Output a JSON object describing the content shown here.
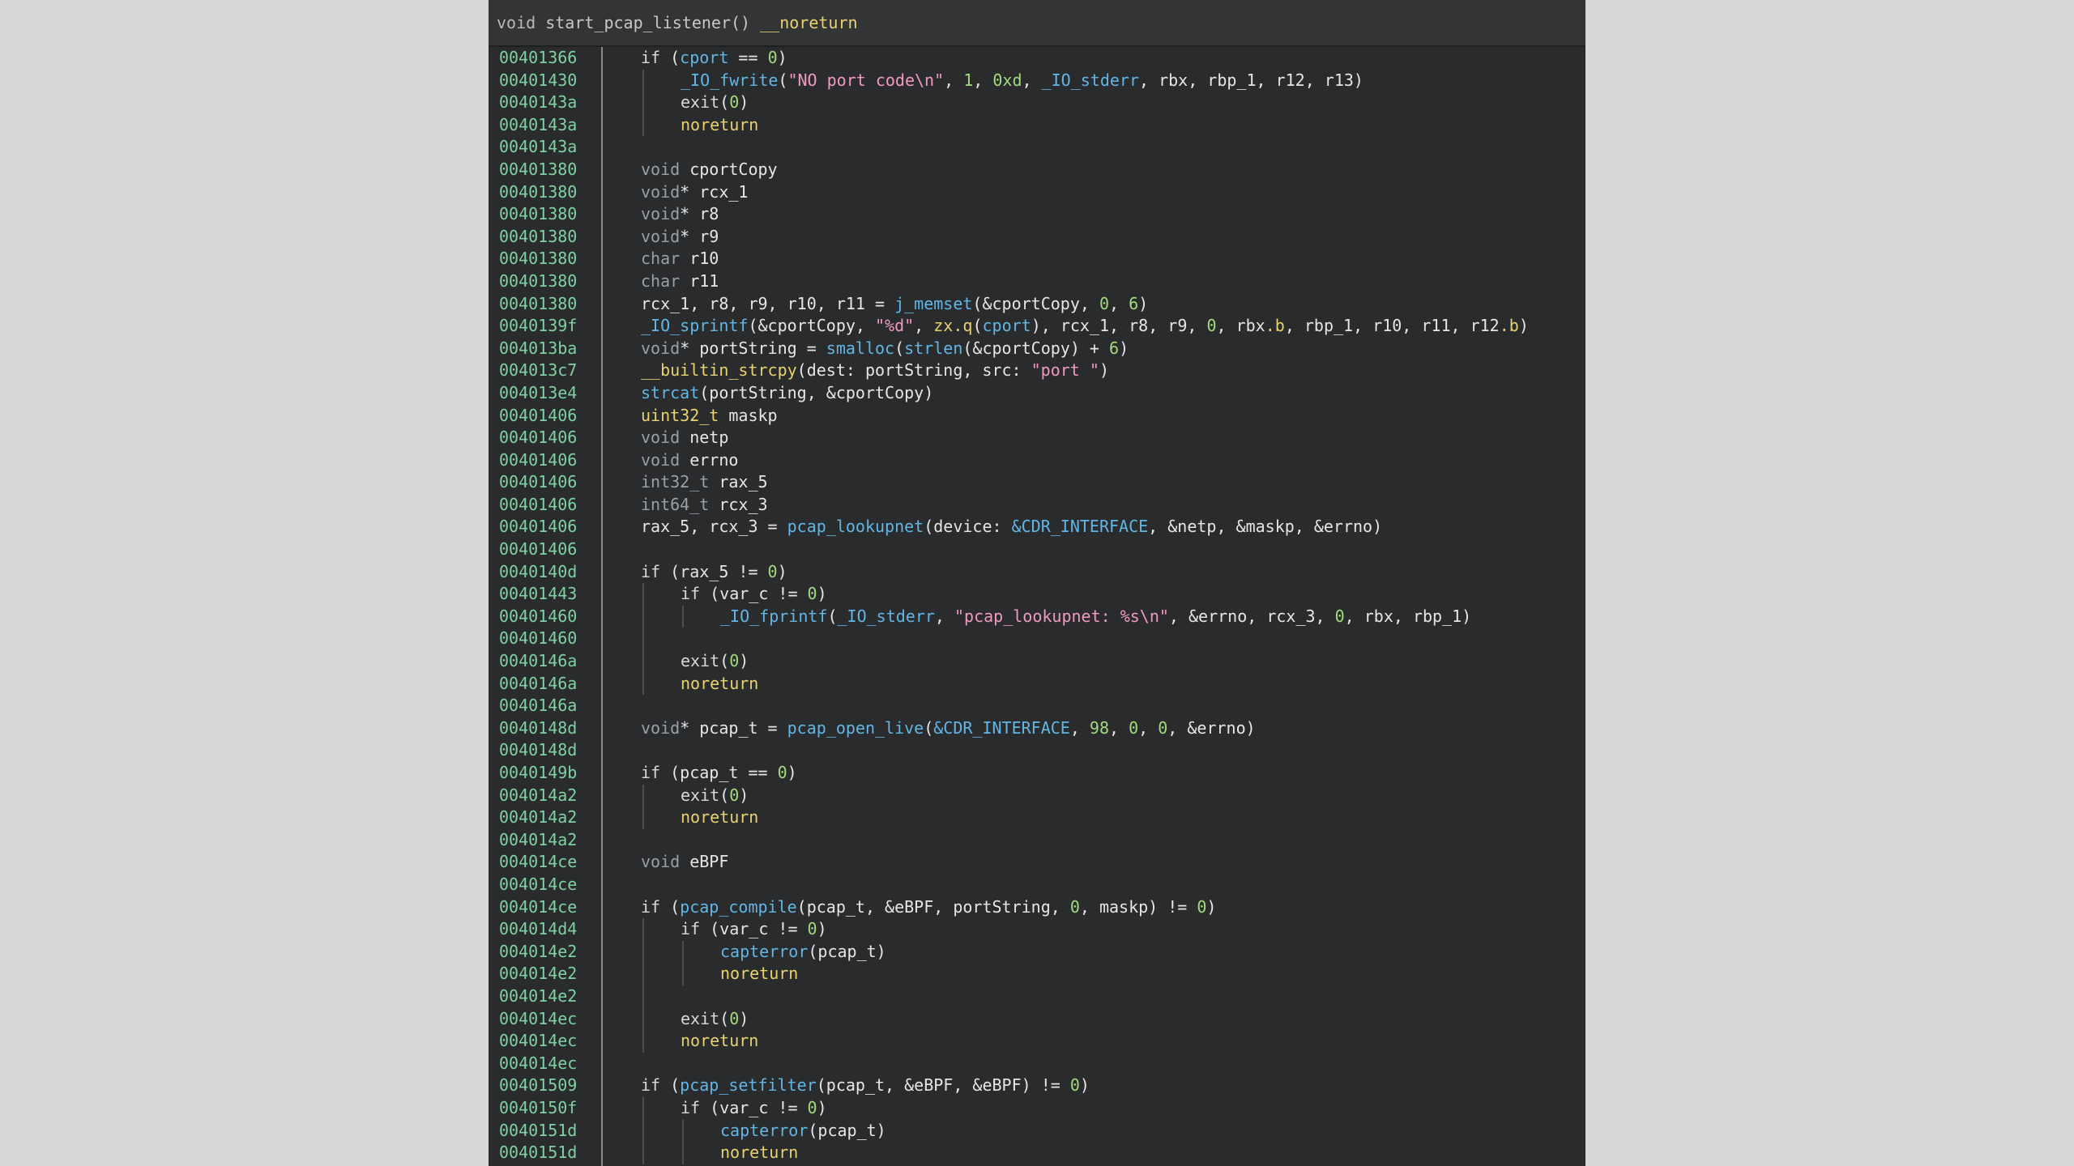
{
  "header": {
    "ret": "void",
    "name": "start_pcap_listener()",
    "attr": "__noreturn"
  },
  "lines": [
    {
      "addr": "00401366",
      "indent": 0,
      "tokens": [
        [
          "kw",
          "if "
        ],
        [
          "",
          ""
        ],
        [
          "",
          "("
        ],
        [
          "fn",
          "cport"
        ],
        [
          "",
          " == "
        ],
        [
          "num",
          "0"
        ],
        [
          "",
          ")"
        ]
      ]
    },
    {
      "addr": "00401430",
      "indent": 1,
      "tokens": [
        [
          "fn",
          "_IO_fwrite"
        ],
        [
          "",
          "("
        ],
        [
          "str",
          "\"NO port code\\n\""
        ],
        [
          "",
          ", "
        ],
        [
          "num",
          "1"
        ],
        [
          "",
          ", "
        ],
        [
          "num",
          "0xd"
        ],
        [
          "",
          ", "
        ],
        [
          "fn",
          "_IO_stderr"
        ],
        [
          "",
          ", rbx, rbp_1, r12, r13)"
        ]
      ]
    },
    {
      "addr": "0040143a",
      "indent": 1,
      "tokens": [
        [
          "kw",
          "exit"
        ],
        [
          "",
          "("
        ],
        [
          "num",
          "0"
        ],
        [
          "",
          ")"
        ]
      ]
    },
    {
      "addr": "0040143a",
      "indent": 1,
      "tokens": [
        [
          "ylw",
          "noreturn"
        ]
      ]
    },
    {
      "addr": "0040143a",
      "indent": 0,
      "tokens": []
    },
    {
      "addr": "00401380",
      "indent": 0,
      "tokens": [
        [
          "ty",
          "void "
        ],
        [
          "",
          "cportCopy"
        ]
      ]
    },
    {
      "addr": "00401380",
      "indent": 0,
      "tokens": [
        [
          "ty",
          "void"
        ],
        [
          "",
          "* rcx_1"
        ]
      ]
    },
    {
      "addr": "00401380",
      "indent": 0,
      "tokens": [
        [
          "ty",
          "void"
        ],
        [
          "",
          "* r8"
        ]
      ]
    },
    {
      "addr": "00401380",
      "indent": 0,
      "tokens": [
        [
          "ty",
          "void"
        ],
        [
          "",
          "* r9"
        ]
      ]
    },
    {
      "addr": "00401380",
      "indent": 0,
      "tokens": [
        [
          "ty",
          "char "
        ],
        [
          "",
          "r10"
        ]
      ]
    },
    {
      "addr": "00401380",
      "indent": 0,
      "tokens": [
        [
          "ty",
          "char "
        ],
        [
          "",
          "r11"
        ]
      ]
    },
    {
      "addr": "00401380",
      "indent": 0,
      "tokens": [
        [
          "",
          "rcx_1, r8, r9, r10, r11 = "
        ],
        [
          "fn",
          "j_memset"
        ],
        [
          "",
          "(&cportCopy, "
        ],
        [
          "num",
          "0"
        ],
        [
          "",
          ", "
        ],
        [
          "num",
          "6"
        ],
        [
          "",
          ")"
        ]
      ]
    },
    {
      "addr": "0040139f",
      "indent": 0,
      "tokens": [
        [
          "fn",
          "_IO_sprintf"
        ],
        [
          "",
          "(&cportCopy, "
        ],
        [
          "str",
          "\"%d\""
        ],
        [
          "",
          ", "
        ],
        [
          "ylw",
          "zx.q"
        ],
        [
          "",
          "("
        ],
        [
          "fn",
          "cport"
        ],
        [
          "",
          "), rcx_1, r8, r9, "
        ],
        [
          "num",
          "0"
        ],
        [
          "",
          ", rbx"
        ],
        [
          "ylw",
          ".b"
        ],
        [
          "",
          ", rbp_1, r10, r11, r12"
        ],
        [
          "ylw",
          ".b"
        ],
        [
          "",
          ")"
        ]
      ]
    },
    {
      "addr": "004013ba",
      "indent": 0,
      "tokens": [
        [
          "ty",
          "void"
        ],
        [
          "",
          "* portString = "
        ],
        [
          "fn",
          "smalloc"
        ],
        [
          "",
          "("
        ],
        [
          "fn",
          "strlen"
        ],
        [
          "",
          "(&cportCopy) + "
        ],
        [
          "num",
          "6"
        ],
        [
          "",
          ")"
        ]
      ]
    },
    {
      "addr": "004013c7",
      "indent": 0,
      "tokens": [
        [
          "ylw",
          "__builtin_strcpy"
        ],
        [
          "",
          "(dest: portString, src: "
        ],
        [
          "str",
          "\"port \""
        ],
        [
          "",
          ")"
        ]
      ]
    },
    {
      "addr": "004013e4",
      "indent": 0,
      "tokens": [
        [
          "fn",
          "strcat"
        ],
        [
          "",
          "(portString, &cportCopy)"
        ]
      ]
    },
    {
      "addr": "00401406",
      "indent": 0,
      "tokens": [
        [
          "ylw",
          "uint32_t "
        ],
        [
          "",
          "maskp"
        ]
      ]
    },
    {
      "addr": "00401406",
      "indent": 0,
      "tokens": [
        [
          "ty",
          "void "
        ],
        [
          "",
          "netp"
        ]
      ]
    },
    {
      "addr": "00401406",
      "indent": 0,
      "tokens": [
        [
          "ty",
          "void "
        ],
        [
          "",
          "errno"
        ]
      ]
    },
    {
      "addr": "00401406",
      "indent": 0,
      "tokens": [
        [
          "ty",
          "int32_t "
        ],
        [
          "",
          "rax_5"
        ]
      ]
    },
    {
      "addr": "00401406",
      "indent": 0,
      "tokens": [
        [
          "ty",
          "int64_t "
        ],
        [
          "",
          "rcx_3"
        ]
      ]
    },
    {
      "addr": "00401406",
      "indent": 0,
      "tokens": [
        [
          "",
          "rax_5, rcx_3 = "
        ],
        [
          "fn",
          "pcap_lookupnet"
        ],
        [
          "",
          "(device: "
        ],
        [
          "fn",
          "&CDR_INTERFACE"
        ],
        [
          "",
          ", &netp, &maskp, &errno)"
        ]
      ]
    },
    {
      "addr": "00401406",
      "indent": 0,
      "tokens": []
    },
    {
      "addr": "0040140d",
      "indent": 0,
      "tokens": [
        [
          "kw",
          "if "
        ],
        [
          "",
          "(rax_5 != "
        ],
        [
          "num",
          "0"
        ],
        [
          "",
          ")"
        ]
      ]
    },
    {
      "addr": "00401443",
      "indent": 1,
      "tokens": [
        [
          "kw",
          "if "
        ],
        [
          "",
          "(var_c != "
        ],
        [
          "num",
          "0"
        ],
        [
          "",
          ")"
        ]
      ]
    },
    {
      "addr": "00401460",
      "indent": 2,
      "tokens": [
        [
          "fn",
          "_IO_fprintf"
        ],
        [
          "",
          "("
        ],
        [
          "fn",
          "_IO_stderr"
        ],
        [
          "",
          ", "
        ],
        [
          "str",
          "\"pcap_lookupnet: %s\\n\""
        ],
        [
          "",
          ", &errno, rcx_3, "
        ],
        [
          "num",
          "0"
        ],
        [
          "",
          ", rbx, rbp_1)"
        ]
      ]
    },
    {
      "addr": "00401460",
      "indent": 1,
      "tokens": []
    },
    {
      "addr": "0040146a",
      "indent": 1,
      "tokens": [
        [
          "kw",
          "exit"
        ],
        [
          "",
          "("
        ],
        [
          "num",
          "0"
        ],
        [
          "",
          ")"
        ]
      ]
    },
    {
      "addr": "0040146a",
      "indent": 1,
      "tokens": [
        [
          "ylw",
          "noreturn"
        ]
      ]
    },
    {
      "addr": "0040146a",
      "indent": 0,
      "tokens": []
    },
    {
      "addr": "0040148d",
      "indent": 0,
      "tokens": [
        [
          "ty",
          "void"
        ],
        [
          "",
          "* pcap_t = "
        ],
        [
          "fn",
          "pcap_open_live"
        ],
        [
          "",
          "("
        ],
        [
          "fn",
          "&CDR_INTERFACE"
        ],
        [
          "",
          ", "
        ],
        [
          "num",
          "98"
        ],
        [
          "",
          ", "
        ],
        [
          "num",
          "0"
        ],
        [
          "",
          ", "
        ],
        [
          "num",
          "0"
        ],
        [
          "",
          ", &errno)"
        ]
      ]
    },
    {
      "addr": "0040148d",
      "indent": 0,
      "tokens": []
    },
    {
      "addr": "0040149b",
      "indent": 0,
      "tokens": [
        [
          "kw",
          "if "
        ],
        [
          "",
          "(pcap_t == "
        ],
        [
          "num",
          "0"
        ],
        [
          "",
          ")"
        ]
      ]
    },
    {
      "addr": "004014a2",
      "indent": 1,
      "tokens": [
        [
          "kw",
          "exit"
        ],
        [
          "",
          "("
        ],
        [
          "num",
          "0"
        ],
        [
          "",
          ")"
        ]
      ]
    },
    {
      "addr": "004014a2",
      "indent": 1,
      "tokens": [
        [
          "ylw",
          "noreturn"
        ]
      ]
    },
    {
      "addr": "004014a2",
      "indent": 0,
      "tokens": []
    },
    {
      "addr": "004014ce",
      "indent": 0,
      "tokens": [
        [
          "ty",
          "void "
        ],
        [
          "",
          "eBPF"
        ]
      ]
    },
    {
      "addr": "004014ce",
      "indent": 0,
      "tokens": []
    },
    {
      "addr": "004014ce",
      "indent": 0,
      "tokens": [
        [
          "kw",
          "if "
        ],
        [
          "",
          "("
        ],
        [
          "fn",
          "pcap_compile"
        ],
        [
          "",
          "(pcap_t, &eBPF, portString, "
        ],
        [
          "num",
          "0"
        ],
        [
          "",
          ", maskp) != "
        ],
        [
          "num",
          "0"
        ],
        [
          "",
          ")"
        ]
      ]
    },
    {
      "addr": "004014d4",
      "indent": 1,
      "tokens": [
        [
          "kw",
          "if "
        ],
        [
          "",
          "(var_c != "
        ],
        [
          "num",
          "0"
        ],
        [
          "",
          ")"
        ]
      ]
    },
    {
      "addr": "004014e2",
      "indent": 2,
      "tokens": [
        [
          "fn",
          "capterror"
        ],
        [
          "",
          "(pcap_t)"
        ]
      ]
    },
    {
      "addr": "004014e2",
      "indent": 2,
      "tokens": [
        [
          "ylw",
          "noreturn"
        ]
      ]
    },
    {
      "addr": "004014e2",
      "indent": 1,
      "tokens": []
    },
    {
      "addr": "004014ec",
      "indent": 1,
      "tokens": [
        [
          "kw",
          "exit"
        ],
        [
          "",
          "("
        ],
        [
          "num",
          "0"
        ],
        [
          "",
          ")"
        ]
      ]
    },
    {
      "addr": "004014ec",
      "indent": 1,
      "tokens": [
        [
          "ylw",
          "noreturn"
        ]
      ]
    },
    {
      "addr": "004014ec",
      "indent": 0,
      "tokens": []
    },
    {
      "addr": "00401509",
      "indent": 0,
      "tokens": [
        [
          "kw",
          "if "
        ],
        [
          "",
          "("
        ],
        [
          "fn",
          "pcap_setfilter"
        ],
        [
          "",
          "(pcap_t, &eBPF, &eBPF) != "
        ],
        [
          "num",
          "0"
        ],
        [
          "",
          ")"
        ]
      ]
    },
    {
      "addr": "0040150f",
      "indent": 1,
      "tokens": [
        [
          "kw",
          "if "
        ],
        [
          "",
          "(var_c != "
        ],
        [
          "num",
          "0"
        ],
        [
          "",
          ")"
        ]
      ]
    },
    {
      "addr": "0040151d",
      "indent": 2,
      "tokens": [
        [
          "fn",
          "capterror"
        ],
        [
          "",
          "(pcap_t)"
        ]
      ]
    },
    {
      "addr": "0040151d",
      "indent": 2,
      "tokens": [
        [
          "ylw",
          "noreturn"
        ]
      ]
    }
  ]
}
